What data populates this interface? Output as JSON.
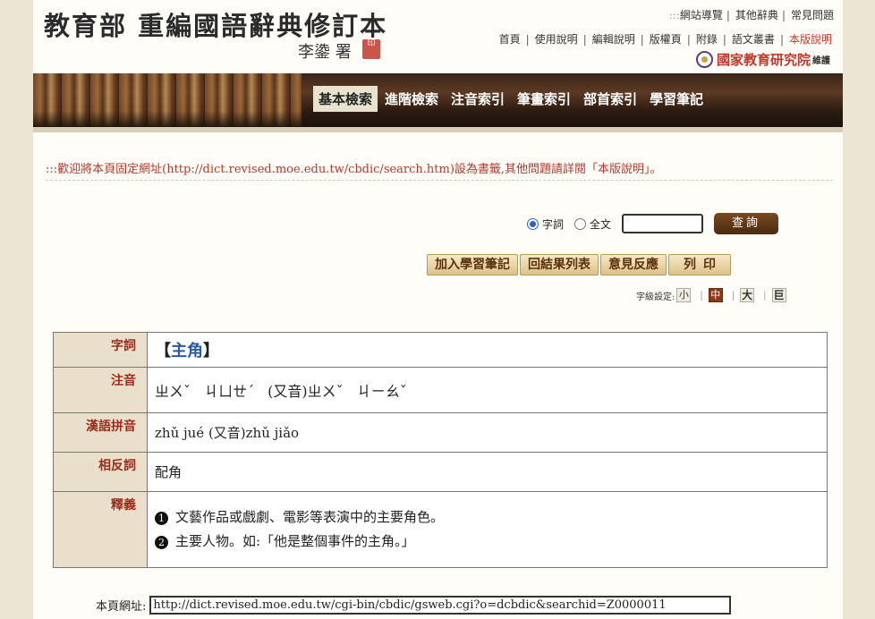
{
  "header": {
    "title": "教育部 重編國語辭典修訂本",
    "author": "李鍌 署",
    "seal": "印",
    "top_links": [
      "網站導覽",
      "其他辭典",
      "常見問題"
    ],
    "top_prefix": ":::",
    "nav_links": [
      "首頁",
      "使用說明",
      "編輯說明",
      "版權頁",
      "附錄",
      "語文叢書",
      "本版說明"
    ],
    "org": "國家教育研究院",
    "org_suffix": "維護"
  },
  "menu": {
    "items": [
      "基本檢索",
      "進階檢索",
      "注音索引",
      "筆畫索引",
      "部首索引",
      "學習筆記"
    ],
    "active_index": 0
  },
  "welcome": ":::歡迎將本頁固定網址(http://dict.revised.moe.edu.tw/cbdic/search.htm)設為書籤,其他問題請詳閱「本版說明」。",
  "search": {
    "option_word": "字詞",
    "option_fulltext": "全文",
    "selected": "字詞",
    "query_value": "",
    "button": "查詢"
  },
  "tools": [
    "加入學習筆記",
    "回結果列表",
    "意見反應",
    "列印"
  ],
  "font_setting": {
    "label": "字級設定:",
    "sizes": [
      "小",
      "中",
      "大",
      "巨"
    ],
    "selected": "中"
  },
  "entry": {
    "labels": {
      "word": "字詞",
      "zhuyin": "注音",
      "pinyin": "漢語拼音",
      "antonym": "相反詞",
      "meaning": "釋義"
    },
    "word_open": "【",
    "word": "主角",
    "word_close": "】",
    "zhuyin": "ㄓㄨˇ ㄐㄩㄝˊ (又音)ㄓㄨˇ ㄐㄧㄠˇ",
    "pinyin": "zhǔ jué (又音)zhǔ jiǎo",
    "antonym": "配角",
    "definitions": [
      {
        "num": "1",
        "text": "文藝作品或戲劇、電影等表演中的主要角色。"
      },
      {
        "num": "2",
        "text": "主要人物。如:「他是整個事件的主角。」"
      }
    ]
  },
  "page_url": {
    "label": "本頁網址:",
    "value": "http://dict.revised.moe.edu.tw/cgi-bin/cbdic/gsweb.cgi?o=dcbdic&searchid=Z0000011"
  },
  "colors": {
    "accent_red": "#c2352a",
    "label_bg": "#eadfcb",
    "button_brown": "#5a3210"
  }
}
